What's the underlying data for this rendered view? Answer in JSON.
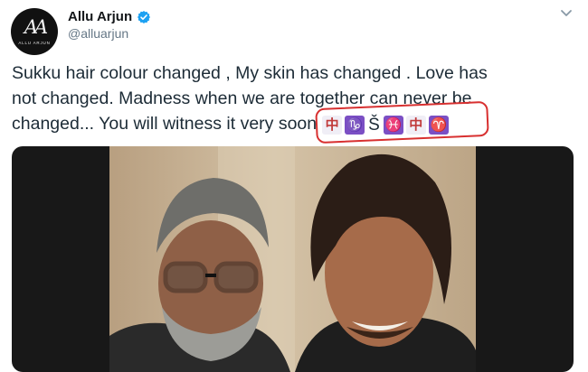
{
  "tweet": {
    "author_name": "Allu Arjun",
    "author_handle": "@alluarjun",
    "avatar_monogram": "AA",
    "avatar_caption": "ALLU ARJUN",
    "verified": true,
    "text_lines": [
      "Sukku hair colour changed , My skin  has changed . Love has",
      "not changed. Madness when we are together can never be",
      "changed... You will witness it very soon"
    ],
    "emojis": [
      {
        "char": "中",
        "icon": "chinese-character-tile",
        "style": "pale"
      },
      {
        "char": "♑",
        "icon": "capricorn-zodiac",
        "style": "purple"
      },
      {
        "char": "Š",
        "icon": "letter-s-caron",
        "style": "plain"
      },
      {
        "char": "♓",
        "icon": "pisces-zodiac",
        "style": "purple"
      },
      {
        "char": "中",
        "icon": "chinese-character-tile",
        "style": "pale"
      },
      {
        "char": "♈",
        "icon": "aries-zodiac",
        "style": "purple"
      }
    ],
    "media": {
      "type": "photo"
    }
  },
  "colors": {
    "verified": "#1da1f2",
    "handle": "#657786",
    "highlight_ring": "#d83030",
    "zodiac_tile": "#7b4fc4"
  }
}
